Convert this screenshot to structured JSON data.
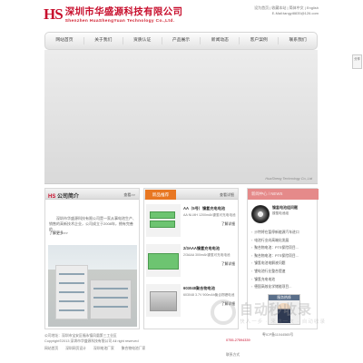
{
  "header": {
    "logo_mark": "HS",
    "company_cn": "深圳市华盛源科技有限公司",
    "company_en": "Shenzhen HuaShengYuan Technology Co.,Ltd.",
    "top_links": "设为首页 | 收藏本站 | 简体中文 | English",
    "email": "E-Mail:tangyi8835@126.com"
  },
  "nav": {
    "items": [
      "网站首页",
      "关于我们",
      "资质认证",
      "产品展示",
      "新闻动态",
      "客户案例",
      "联系我们"
    ]
  },
  "banner": {
    "caption": "HuaSheng Technology Co.,Ltd",
    "side_thumb": "分享"
  },
  "about": {
    "title_mark": "HS",
    "title": "公司简介",
    "more": "查看>>",
    "text": "深圳市华盛源科技有限公司是一家从事电池生产、销售的高新技术企业，公司成立于2008年，拥有完善的...",
    "more_link": "了解更多>>"
  },
  "products": {
    "tab": "新品推荐",
    "more": "查看详细",
    "items": [
      {
        "name": "AA（5号）镍氢充电电池",
        "desc": "AA NI-MH 1200mAh镍氢可充电电池",
        "link": "了解详细"
      },
      {
        "name": "2/3AAA镍氢充电电池",
        "desc": "2/3AAA 300mAh镍氢可充电电池",
        "link": "了解详细"
      },
      {
        "name": "603048聚合物电池",
        "desc": "603048 3.7V 900mAh聚合物锂电池",
        "link": "了解详细"
      }
    ]
  },
  "news": {
    "tab": "新闻中心",
    "tab_en": "/ NEWS",
    "feature_title": "镍氢电池组问题",
    "feature_sub": "镍氢电池组",
    "items": [
      "沙特将在暂停新能源汽车进口",
      "电池行业向高端化发展",
      "聚合物电池：PTS保险项目...",
      "聚合物电池：PTS保险项目...",
      "镍氢电池电解液问题",
      "锂电池行业整合提速",
      "镍氢充电电池",
      "德国高效化学储能项目..."
    ],
    "service_title": "服务热线"
  },
  "watermark": {
    "big": "自动秒收录",
    "small": "快人一步 · 来访一次 · 自动收录"
  },
  "footer": {
    "company_line": "公司地址：深圳市宝安区福永镇凤凰第三工业区",
    "copyright": "Copyright©2013 深圳市华盛源科技有限公司 All right reserved",
    "phone": "0755-27594339",
    "links": [
      "网站首页",
      "深圳网页设计",
      "深圳电池厂家",
      "聚合物电池厂家"
    ],
    "icp": "粤ICP备11044565号",
    "cart": "联系方式"
  },
  "colors": {
    "brand_red": "#c8102e",
    "accent_orange": "#e87722",
    "news_pink": "#e58a8a"
  }
}
